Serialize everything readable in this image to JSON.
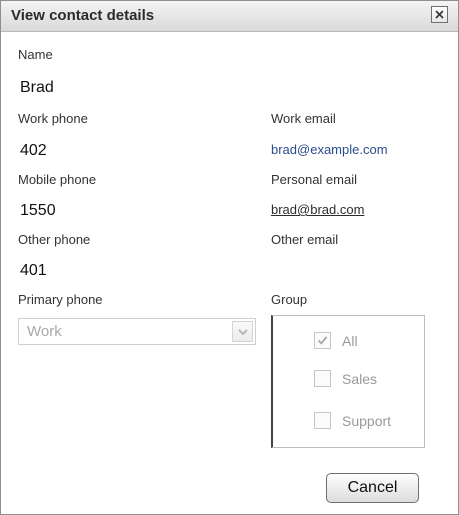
{
  "dialog": {
    "title": "View contact details",
    "close_icon": "close-icon"
  },
  "contact": {
    "name_label": "Name",
    "name_value": "Brad",
    "work_phone_label": "Work phone",
    "work_phone_value": "402",
    "mobile_phone_label": "Mobile phone",
    "mobile_phone_value": "1550",
    "other_phone_label": "Other phone",
    "other_phone_value": "401",
    "primary_phone_label": "Primary phone",
    "primary_phone_value": "Work",
    "work_email_label": "Work email",
    "work_email_value": "brad@example.com",
    "personal_email_label": "Personal email",
    "personal_email_value": "brad@brad.com",
    "other_email_label": "Other email",
    "other_email_value": ""
  },
  "group": {
    "label": "Group",
    "options": [
      {
        "label": "All",
        "checked": true
      },
      {
        "label": "Sales",
        "checked": false
      },
      {
        "label": "Support",
        "checked": false
      }
    ]
  },
  "buttons": {
    "cancel_label": "Cancel"
  }
}
